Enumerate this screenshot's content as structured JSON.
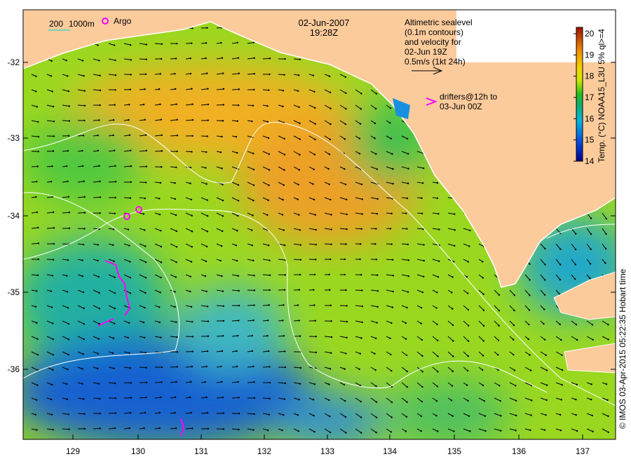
{
  "title": {
    "date": "02-Jun-2007",
    "time": "19:28Z"
  },
  "legend": {
    "scale_200": "200",
    "scale_1000": "1000m",
    "argo": "Argo",
    "altimetry_lines": [
      "Altimetric sealevel",
      "(0.1m contours)",
      "and velocity for",
      "02-Jun 19Z",
      "0.5m/s (1kt 24h)"
    ],
    "drifters_lines": [
      "drifters@12h to",
      "03-Jun 00Z"
    ]
  },
  "colorbar": {
    "label": "Temp. (°C) NOAA15_L3U 5% ql>=4",
    "ticks": [
      "20",
      "19",
      "18",
      "17",
      "16",
      "15",
      "14"
    ],
    "range": [
      14,
      20.3
    ]
  },
  "axes": {
    "lat_ticks": [
      "-32",
      "-33",
      "-34",
      "-35",
      "-36"
    ],
    "lon_ticks": [
      "129",
      "130",
      "131",
      "132",
      "133",
      "134",
      "135",
      "136",
      "137"
    ]
  },
  "credit": "© IMOS 03-Apr-2015 05:22:35 Hobart time",
  "colors": {
    "land": "#fccb9c",
    "argo": "#ff00ff",
    "drifter": "#ff00ff",
    "contour": "#ffffff"
  }
}
